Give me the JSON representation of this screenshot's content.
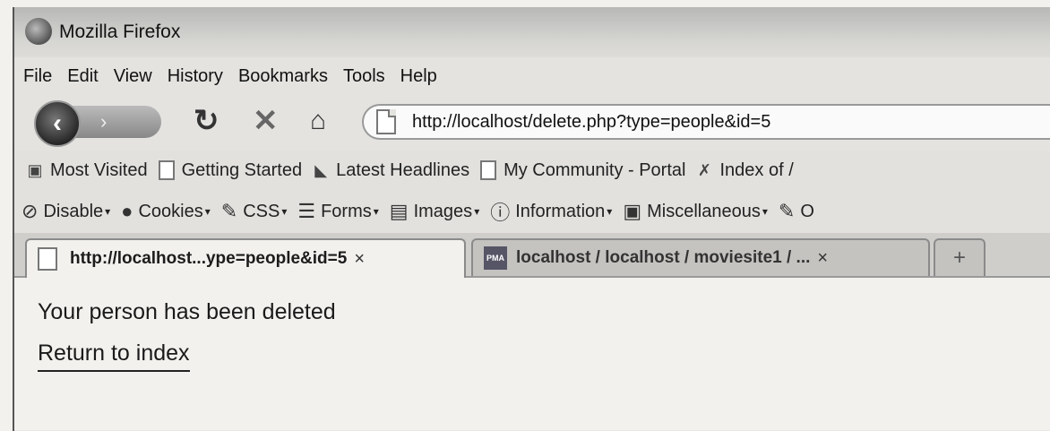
{
  "window": {
    "title": "Mozilla Firefox"
  },
  "menu": [
    "File",
    "Edit",
    "View",
    "History",
    "Bookmarks",
    "Tools",
    "Help"
  ],
  "nav": {
    "back_glyph": "‹",
    "forward_glyph": "›",
    "url": "http://localhost/delete.php?type=people&id=5"
  },
  "bookmarks": [
    {
      "label": "Most Visited",
      "icon": "most-visited-icon"
    },
    {
      "label": "Getting Started",
      "icon": "page-icon"
    },
    {
      "label": "Latest Headlines",
      "icon": "rss-icon"
    },
    {
      "label": "My Community - Portal",
      "icon": "page-icon"
    },
    {
      "label": "Index of /",
      "icon": "index-icon"
    }
  ],
  "devtools": [
    {
      "label": "Disable",
      "icon": "disable-icon"
    },
    {
      "label": "Cookies",
      "icon": "cookies-icon"
    },
    {
      "label": "CSS",
      "icon": "css-icon"
    },
    {
      "label": "Forms",
      "icon": "forms-icon"
    },
    {
      "label": "Images",
      "icon": "images-icon"
    },
    {
      "label": "Information",
      "icon": "information-icon"
    },
    {
      "label": "Miscellaneous",
      "icon": "miscellaneous-icon"
    },
    {
      "label": "O",
      "icon": "outline-icon"
    }
  ],
  "tabs": [
    {
      "label": "http://localhost...ype=people&id=5",
      "icon": "page-icon",
      "active": true
    },
    {
      "label": "localhost / localhost / moviesite1 / ...",
      "icon": "phpmyadmin-icon",
      "active": false
    }
  ],
  "tab_close_glyph": "×",
  "new_tab_glyph": "+",
  "pma_icon_text": "PMA",
  "page": {
    "message": "Your person has been deleted",
    "link": "Return to index"
  }
}
